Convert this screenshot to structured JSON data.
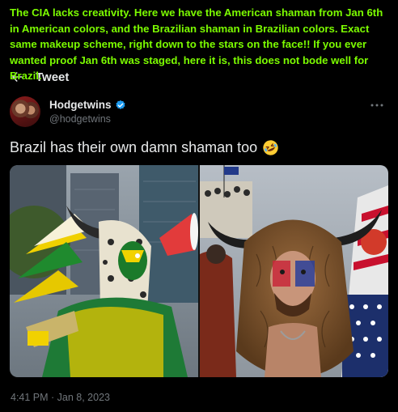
{
  "caption": {
    "text": "The CIA lacks creativity.  Here we have the American shaman from Jan 6th in American colors, and the Brazilian shaman in Brazilian colors.  Exact same makeup scheme, right down to the stars on the face!!  If you ever wanted proof Jan 6th was staged, here it is, this does not bode well for Brazil.",
    "color": "#7cfc00"
  },
  "header": {
    "title": "Tweet",
    "back_icon": "arrow-left-icon"
  },
  "author": {
    "display_name": "Hodgetwins",
    "handle": "@hodgetwins",
    "verified": true,
    "verified_color": "#1d9bf0",
    "more_icon": "more-horizontal-icon"
  },
  "tweet": {
    "text": "Brazil has their own damn shaman too",
    "emoji": "rolling-on-floor-laughing-emoji"
  },
  "media": {
    "images": [
      {
        "icon": "photo-brazilian-shaman"
      },
      {
        "icon": "photo-american-shaman"
      }
    ]
  },
  "meta": {
    "timestamp": "4:41 PM · Jan 8, 2023"
  },
  "colors": {
    "background": "#000000",
    "text_primary": "#e7e9ea",
    "text_secondary": "#71767b"
  }
}
